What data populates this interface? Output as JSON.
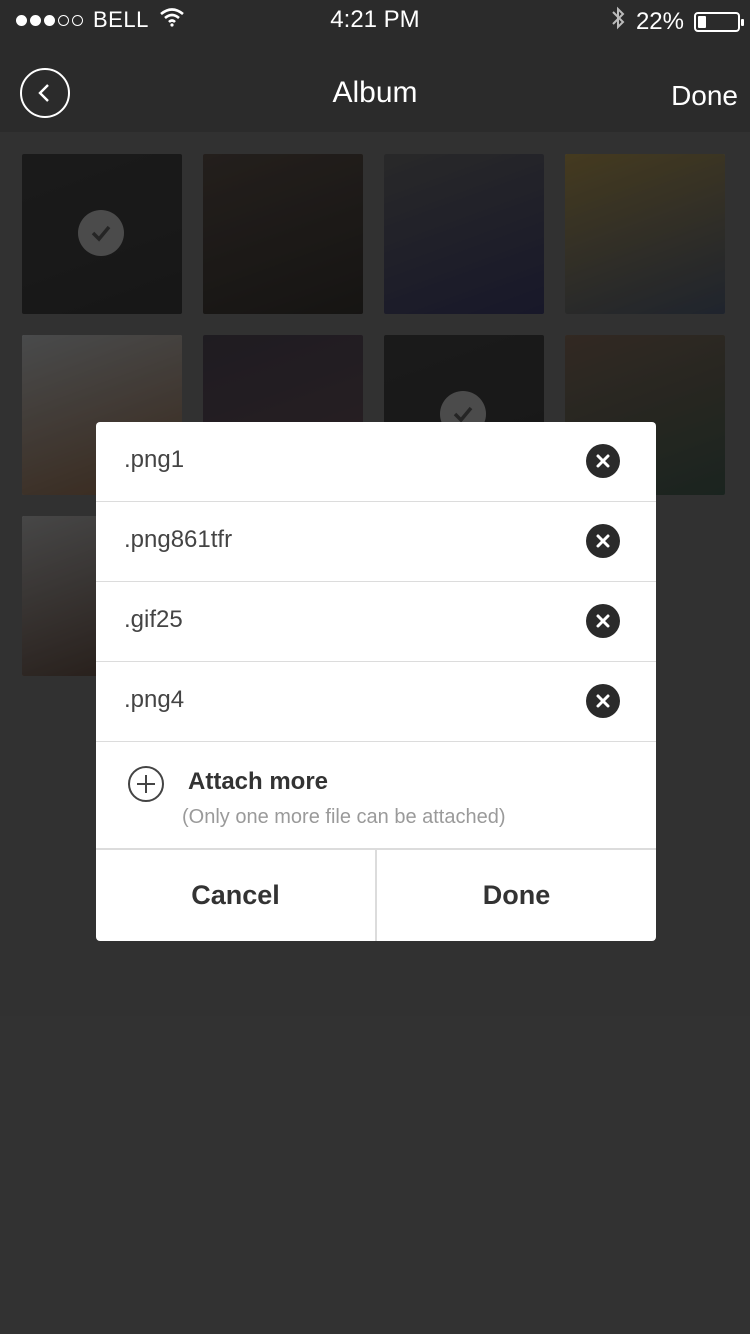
{
  "status_bar": {
    "carrier": "BELL",
    "time": "4:21 PM",
    "battery_text": "22%",
    "battery_level": 0.22
  },
  "nav": {
    "title": "Album",
    "done_label": "Done"
  },
  "photos": [
    {
      "colors": [
        "#3a3a3a",
        "#2e2e2e"
      ],
      "selected": true
    },
    {
      "colors": [
        "#5a4a40",
        "#2a2520"
      ],
      "selected": false
    },
    {
      "colors": [
        "#6a6a6a",
        "#30306a"
      ],
      "selected": false
    },
    {
      "colors": [
        "#c9a64a",
        "#4a5a7a"
      ],
      "selected": false
    },
    {
      "colors": [
        "#d8dde0",
        "#a06a40"
      ],
      "selected": false
    },
    {
      "colors": [
        "#4a4050",
        "#6a4a5a"
      ],
      "selected": false
    },
    {
      "colors": [
        "#3a3a3a",
        "#2e2e2e"
      ],
      "selected": true
    },
    {
      "colors": [
        "#8a6a55",
        "#3a5a4a"
      ],
      "selected": false
    },
    {
      "colors": [
        "#d0d0d0",
        "#5a3a2a"
      ],
      "selected": false
    },
    {
      "colors": [
        "#7a5a45",
        "#2a2a4a"
      ],
      "selected": false
    }
  ],
  "dialog": {
    "files": [
      {
        "name": ".png1"
      },
      {
        "name": ".png861tfr"
      },
      {
        "name": ".gif25"
      },
      {
        "name": ".png4"
      }
    ],
    "attach_label": "Attach more",
    "attach_hint": "(Only one more file can be attached)",
    "cancel_label": "Cancel",
    "done_label": "Done"
  }
}
